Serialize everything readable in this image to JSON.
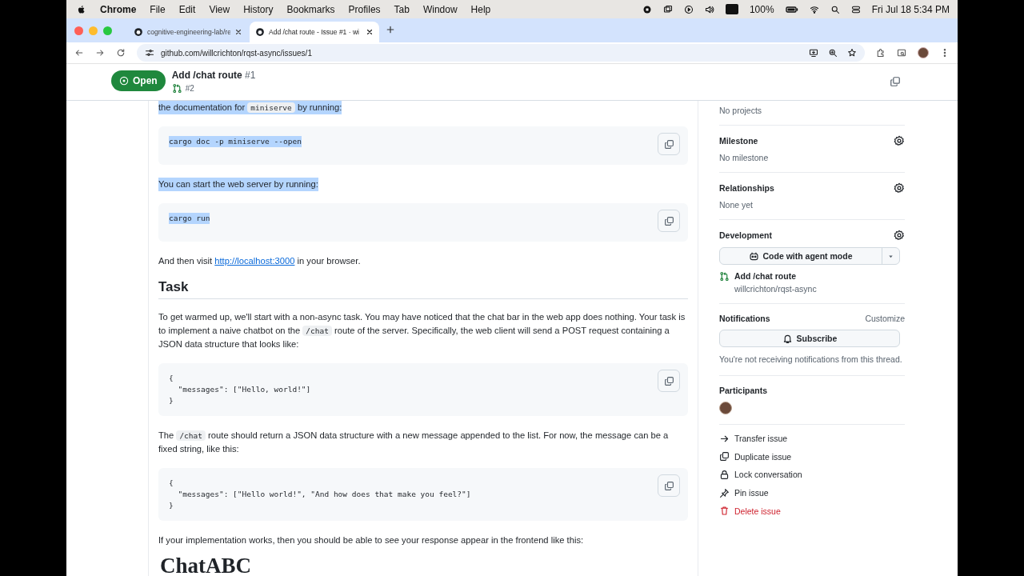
{
  "menubar": {
    "app": "Chrome",
    "items": [
      "File",
      "Edit",
      "View",
      "History",
      "Bookmarks",
      "Profiles",
      "Tab",
      "Window",
      "Help"
    ],
    "battery": "100%",
    "clock": "Fri Jul 18  5:34 PM"
  },
  "tabs": [
    {
      "title": "cognitive-engineering-lab/re",
      "selected": false
    },
    {
      "title": "Add /chat route - Issue #1 · wi",
      "selected": true
    }
  ],
  "address": "github.com/willcrichton/rqst-async/issues/1",
  "issue": {
    "state": "Open",
    "title": "Add /chat route",
    "number": "#1",
    "linked_pr": "#2"
  },
  "body": [
    {
      "kind": "paragraph",
      "highlighted": true,
      "parts": [
        {
          "kind": "text",
          "text": "the documentation for "
        },
        {
          "kind": "code",
          "text": "miniserve"
        },
        {
          "kind": "text",
          "text": " by running:"
        }
      ]
    },
    {
      "kind": "code",
      "highlighted": true,
      "lines": [
        "cargo doc -p miniserve --open"
      ]
    },
    {
      "kind": "paragraph",
      "highlighted": true,
      "parts": [
        {
          "kind": "text",
          "text": "You can start the web server by running:"
        }
      ]
    },
    {
      "kind": "code",
      "highlighted": true,
      "lines": [
        "cargo run"
      ]
    },
    {
      "kind": "paragraph",
      "highlighted": false,
      "parts": [
        {
          "kind": "text",
          "text": "And then visit "
        },
        {
          "kind": "link",
          "text": "http://localhost:3000"
        },
        {
          "kind": "text",
          "text": " in your browser."
        }
      ]
    },
    {
      "kind": "heading",
      "text": "Task"
    },
    {
      "kind": "paragraph",
      "highlighted": false,
      "parts": [
        {
          "kind": "text",
          "text": "To get warmed up, we'll start with a non-async task. You may have noticed that the chat bar in the web app does nothing. Your task is to implement a naive chatbot on the "
        },
        {
          "kind": "code",
          "text": "/chat"
        },
        {
          "kind": "text",
          "text": " route of the server. Specifically, the web client will send a POST request containing a JSON data structure that looks like:"
        }
      ]
    },
    {
      "kind": "code",
      "highlighted": false,
      "lines": [
        "{",
        "  \"messages\": [\"Hello, world!\"]",
        "}"
      ]
    },
    {
      "kind": "paragraph",
      "highlighted": false,
      "parts": [
        {
          "kind": "text",
          "text": "The "
        },
        {
          "kind": "code",
          "text": "/chat"
        },
        {
          "kind": "text",
          "text": " route should return a JSON data structure with a new message appended to the list. For now, the message can be a fixed string, like this:"
        }
      ]
    },
    {
      "kind": "code",
      "highlighted": false,
      "lines": [
        "{",
        "  \"messages\": [\"Hello world!\", \"And how does that make you feel?\"]",
        "}"
      ]
    },
    {
      "kind": "paragraph",
      "highlighted": false,
      "parts": [
        {
          "kind": "text",
          "text": "If your implementation works, then you should be able to see your response appear in the frontend like this:"
        }
      ]
    },
    {
      "kind": "demo_heading",
      "text": "ChatABC"
    }
  ],
  "sidebar": {
    "projects": "No projects",
    "sections": [
      {
        "title": "Milestone",
        "value": "No milestone"
      },
      {
        "title": "Relationships",
        "value": "None yet"
      }
    ],
    "development": {
      "title": "Development",
      "button": "Code with agent mode",
      "pr_title": "Add /chat route",
      "pr_repo": "willcrichton/rqst-async"
    },
    "notifications": {
      "title": "Notifications",
      "customize": "Customize",
      "button": "Subscribe",
      "note": "You're not receiving notifications from this thread."
    },
    "participants": {
      "title": "Participants"
    },
    "actions": [
      {
        "kind": "transfer",
        "label": "Transfer issue"
      },
      {
        "kind": "duplicate",
        "label": "Duplicate issue"
      },
      {
        "kind": "lock",
        "label": "Lock conversation"
      },
      {
        "kind": "pin",
        "label": "Pin issue"
      },
      {
        "kind": "delete",
        "label": "Delete issue"
      }
    ]
  }
}
